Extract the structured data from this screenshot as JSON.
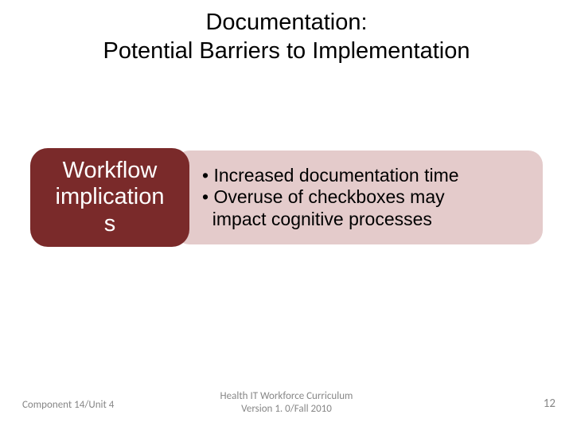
{
  "title": {
    "line1": "Documentation:",
    "line2": "Potential Barriers to Implementation"
  },
  "left_pill": {
    "line1": "Workflow",
    "line2": "implication",
    "line3": "s"
  },
  "right_pill": {
    "bullet1": "• Increased documentation time",
    "bullet2": "• Overuse of checkboxes may",
    "bullet2b": "  impact cognitive processes"
  },
  "footer": {
    "left": "Component 14/Unit 4",
    "center_line1": "Health IT Workforce Curriculum",
    "center_line2": "Version 1. 0/Fall 2010",
    "right": "12"
  }
}
